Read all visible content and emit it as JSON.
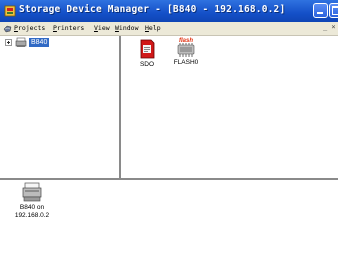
{
  "window": {
    "title": "Storage Device Manager - [B840 - 192.168.0.2]",
    "accent": "#1450c8"
  },
  "menu": {
    "items": [
      "Projects",
      "Printers",
      "View",
      "Window",
      "Help"
    ],
    "mdi_controls": "_ ×"
  },
  "tree": {
    "root_label": "B840",
    "root_icon": "printer-icon"
  },
  "devices": [
    {
      "label": "SDO",
      "icon": "sd-card-icon",
      "color": "#d01818"
    },
    {
      "label": "FLASH0",
      "icon": "flash-chip-icon",
      "badge": "flash",
      "badge_color": "#e03010"
    }
  ],
  "servers": [
    {
      "label": "B840 on 192.168.0.2",
      "icon": "printer-icon"
    }
  ]
}
